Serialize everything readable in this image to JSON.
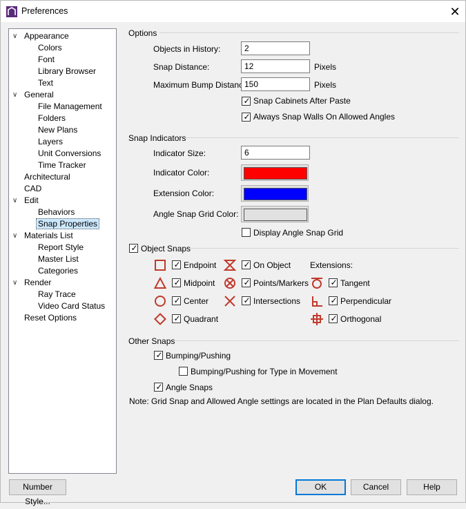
{
  "window": {
    "title": "Preferences",
    "close_glyph": "✕"
  },
  "tree": [
    {
      "label": "Appearance",
      "level": 0,
      "expanded": true
    },
    {
      "label": "Colors",
      "level": 1
    },
    {
      "label": "Font",
      "level": 1
    },
    {
      "label": "Library Browser",
      "level": 1
    },
    {
      "label": "Text",
      "level": 1
    },
    {
      "label": "General",
      "level": 0,
      "expanded": true
    },
    {
      "label": "File Management",
      "level": 1
    },
    {
      "label": "Folders",
      "level": 1
    },
    {
      "label": "New Plans",
      "level": 1
    },
    {
      "label": "Layers",
      "level": 1
    },
    {
      "label": "Unit Conversions",
      "level": 1
    },
    {
      "label": "Time Tracker",
      "level": 1
    },
    {
      "label": "Architectural",
      "level": 0
    },
    {
      "label": "CAD",
      "level": 0
    },
    {
      "label": "Edit",
      "level": 0,
      "expanded": true
    },
    {
      "label": "Behaviors",
      "level": 1
    },
    {
      "label": "Snap Properties",
      "level": 1,
      "selected": true
    },
    {
      "label": "Materials List",
      "level": 0,
      "expanded": true
    },
    {
      "label": "Report Style",
      "level": 1
    },
    {
      "label": "Master List",
      "level": 1
    },
    {
      "label": "Categories",
      "level": 1
    },
    {
      "label": "Render",
      "level": 0,
      "expanded": true
    },
    {
      "label": "Ray Trace",
      "level": 1
    },
    {
      "label": "Video Card Status",
      "level": 1
    },
    {
      "label": "Reset Options",
      "level": 0
    }
  ],
  "options": {
    "header": "Options",
    "history_label": "Objects in History:",
    "history_value": "2",
    "snap_distance_label": "Snap Distance:",
    "snap_distance_value": "12",
    "snap_distance_unit": "Pixels",
    "bump_label": "Maximum Bump Distance:",
    "bump_value": "150",
    "bump_unit": "Pixels",
    "snap_cabinets_label": "Snap Cabinets After Paste",
    "snap_cabinets_checked": true,
    "snap_walls_label": "Always Snap Walls On Allowed Angles",
    "snap_walls_checked": true
  },
  "snap_indicators": {
    "header": "Snap Indicators",
    "size_label": "Indicator Size:",
    "size_value": "6",
    "indicator_color_label": "Indicator Color:",
    "indicator_color": "#ff0000",
    "extension_color_label": "Extension Color:",
    "extension_color": "#0000ff",
    "grid_color_label": "Angle Snap Grid Color:",
    "grid_color": "#e1e1e1",
    "display_grid_label": "Display Angle Snap Grid",
    "display_grid_checked": false
  },
  "object_snaps": {
    "header": "Object Snaps",
    "enabled": true,
    "endpoint": "Endpoint",
    "midpoint": "Midpoint",
    "center": "Center",
    "quadrant": "Quadrant",
    "on_object": "On Object",
    "points_markers": "Points/Markers",
    "intersections": "Intersections",
    "extensions_label": "Extensions:",
    "tangent": "Tangent",
    "perpendicular": "Perpendicular",
    "orthogonal": "Orthogonal",
    "icon_color": "#c0392b"
  },
  "other_snaps": {
    "header": "Other Snaps",
    "bumping_label": "Bumping/Pushing",
    "bumping_checked": true,
    "bumping_type_label": "Bumping/Pushing for Type in Movement",
    "bumping_type_checked": false,
    "angle_snaps_label": "Angle Snaps",
    "angle_snaps_checked": true,
    "note": "Note: Grid Snap and Allowed Angle settings are located in the Plan Defaults dialog."
  },
  "buttons": {
    "number_style": "Number Style...",
    "ok": "OK",
    "cancel": "Cancel",
    "help": "Help"
  }
}
